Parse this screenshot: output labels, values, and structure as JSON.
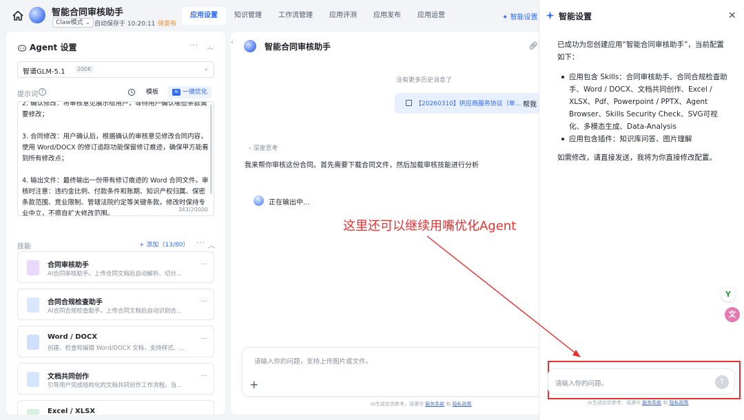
{
  "header": {
    "app_title": "智能合同审核助手",
    "mode": "Claw模式 ⌄",
    "autosave": "自动保存于 10:20:11",
    "status": "待发布",
    "tabs": [
      "应用设置",
      "知识管理",
      "工作流管理",
      "应用评测",
      "应用发布",
      "应用运营"
    ],
    "smart_settings_tab": "智能设置"
  },
  "left_panel": {
    "title": "Agent 设置",
    "model_name": "智谱GLM-5.1",
    "model_tag": "200K",
    "prompt_label": "提示词",
    "template_button": "模板",
    "optimize_button": "一键优化",
    "prompt_text": "2. 确认修改：将审核意见展示给用户，等待用户确认哪些条款需要修改；\n\n3. 合同修改：用户确认后，根据确认的审核意见修改合同内容，使用 Word/DOCX 的修订追踪功能保留修订痕迹，确保甲方能看到所有修改点；\n\n4. 输出文件：最终输出一份带有修订痕迹的 Word 合同文件。审核时注意：违约金比例、付款条件和账期、知识产权归属、保密条款范围、竞业限制、管辖法院约定等关键条款。修改时保持专业中立，不擅自扩大修改范围。",
    "prompt_count": "343/20000",
    "skills_label": "技能",
    "add_skill": "+ 添加（13/80）",
    "skills": [
      {
        "name": "合同审核助手",
        "desc": "AI合同审核助手。上传合同文档后自动解析、切分..."
      },
      {
        "name": "合同合规检查助手",
        "desc": "AI合同合规检查助手。上传合同文档后自动识别合..."
      },
      {
        "name": "Word / DOCX",
        "desc": "创建、检查和编辑 Word/DOCX 文档，支持样式、..."
      },
      {
        "name": "文档共同创作",
        "desc": "引导用户完成结构化的文档共同创作工作流程。当..."
      },
      {
        "name": "Excel / XLSX",
        "desc": ""
      }
    ]
  },
  "center_panel": {
    "title": "智能合同审核助手",
    "no_history": "没有更多历史消息了",
    "file_name": "【20260310】供应商服务协议（单...",
    "user_text": "帮我",
    "deep_think": "深度思考",
    "ai_reply": "我来帮你审核这份合同。首先需要下载合同文件，然后加载审核技能进行分析",
    "outputting": "正在输出中...",
    "annotation": "这里还可以继续用嘴优化Agent",
    "input_placeholder": "请输入你的问题，支持上传图片或文件。",
    "disclaimer_prefix": "AI生成仅供参考，请遵守",
    "disclaimer_terms": "服务条款",
    "disclaimer_and": "和",
    "disclaimer_privacy": "隐私政策"
  },
  "right_panel": {
    "title": "智能设置",
    "intro": "已成功为您创建应用“智能合同审核助手”，当前配置如下：",
    "bullets": [
      "应用包含 Skills：合同审核助手、合同合规检查助手、Word / DOCX、文档共同创作、Excel / XLSX、Pdf、Powerpoint / PPTX、Agent Browser、Skills Security Check、SVG可视化、多模态生成、Data-Analysis",
      "应用包含插件：知识库问答、图片理解"
    ],
    "closing": "如需修改，请直接发送，我将为你直接修改配置。",
    "input_placeholder": "请输入你的问题。",
    "disclaimer_prefix": "AI生成仅供参考，请遵守",
    "disclaimer_terms": "服务条款",
    "disclaimer_and": "和",
    "disclaimer_privacy": "隐私政策"
  },
  "colors": {
    "accent": "#2f6bff",
    "annotation": "#e8302f",
    "pending": "#f08a24"
  }
}
